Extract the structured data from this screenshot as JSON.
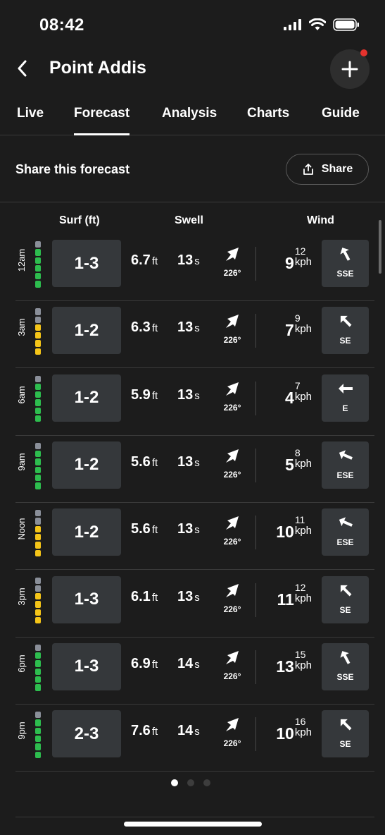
{
  "status_bar": {
    "time": "08:42"
  },
  "header": {
    "title": "Point Addis"
  },
  "tabs": [
    {
      "label": "Live",
      "active": false
    },
    {
      "label": "Forecast",
      "active": true
    },
    {
      "label": "Analysis",
      "active": false
    },
    {
      "label": "Charts",
      "active": false
    },
    {
      "label": "Guide",
      "active": false
    }
  ],
  "share": {
    "text": "Share this forecast",
    "button_label": "Share"
  },
  "columns": {
    "surf": "Surf (ft)",
    "swell": "Swell",
    "wind": "Wind"
  },
  "colors": {
    "green": "#2dbd4e",
    "yellow": "#f5c518",
    "grey": "#8a8f99"
  },
  "rows": [
    {
      "time": "12am",
      "meter": [
        "grey",
        "green",
        "green",
        "green",
        "green",
        "green"
      ],
      "surf": "1-3",
      "swell_height": "6.7",
      "swell_height_unit": "ft",
      "swell_period": "13",
      "swell_period_unit": "s",
      "swell_direction": "226°",
      "wind_speed": "9",
      "wind_gust": "12",
      "wind_unit": "kph",
      "wind_direction": "SSE"
    },
    {
      "time": "3am",
      "meter": [
        "grey",
        "grey",
        "yellow",
        "yellow",
        "yellow",
        "yellow"
      ],
      "surf": "1-2",
      "swell_height": "6.3",
      "swell_height_unit": "ft",
      "swell_period": "13",
      "swell_period_unit": "s",
      "swell_direction": "226°",
      "wind_speed": "7",
      "wind_gust": "9",
      "wind_unit": "kph",
      "wind_direction": "SE"
    },
    {
      "time": "6am",
      "meter": [
        "grey",
        "green",
        "green",
        "green",
        "green",
        "green"
      ],
      "surf": "1-2",
      "swell_height": "5.9",
      "swell_height_unit": "ft",
      "swell_period": "13",
      "swell_period_unit": "s",
      "swell_direction": "226°",
      "wind_speed": "4",
      "wind_gust": "7",
      "wind_unit": "kph",
      "wind_direction": "E"
    },
    {
      "time": "9am",
      "meter": [
        "grey",
        "green",
        "green",
        "green",
        "green",
        "green"
      ],
      "surf": "1-2",
      "swell_height": "5.6",
      "swell_height_unit": "ft",
      "swell_period": "13",
      "swell_period_unit": "s",
      "swell_direction": "226°",
      "wind_speed": "5",
      "wind_gust": "8",
      "wind_unit": "kph",
      "wind_direction": "ESE"
    },
    {
      "time": "Noon",
      "meter": [
        "grey",
        "grey",
        "yellow",
        "yellow",
        "yellow",
        "yellow"
      ],
      "surf": "1-2",
      "swell_height": "5.6",
      "swell_height_unit": "ft",
      "swell_period": "13",
      "swell_period_unit": "s",
      "swell_direction": "226°",
      "wind_speed": "10",
      "wind_gust": "11",
      "wind_unit": "kph",
      "wind_direction": "ESE"
    },
    {
      "time": "3pm",
      "meter": [
        "grey",
        "grey",
        "yellow",
        "yellow",
        "yellow",
        "yellow"
      ],
      "surf": "1-3",
      "swell_height": "6.1",
      "swell_height_unit": "ft",
      "swell_period": "13",
      "swell_period_unit": "s",
      "swell_direction": "226°",
      "wind_speed": "11",
      "wind_gust": "12",
      "wind_unit": "kph",
      "wind_direction": "SE"
    },
    {
      "time": "6pm",
      "meter": [
        "grey",
        "green",
        "green",
        "green",
        "green",
        "green"
      ],
      "surf": "1-3",
      "swell_height": "6.9",
      "swell_height_unit": "ft",
      "swell_period": "14",
      "swell_period_unit": "s",
      "swell_direction": "226°",
      "wind_speed": "13",
      "wind_gust": "15",
      "wind_unit": "kph",
      "wind_direction": "SSE"
    },
    {
      "time": "9pm",
      "meter": [
        "grey",
        "green",
        "green",
        "green",
        "green",
        "green"
      ],
      "surf": "2-3",
      "swell_height": "7.6",
      "swell_height_unit": "ft",
      "swell_period": "14",
      "swell_period_unit": "s",
      "swell_direction": "226°",
      "wind_speed": "10",
      "wind_gust": "16",
      "wind_unit": "kph",
      "wind_direction": "SE"
    }
  ],
  "pagination": {
    "pages": 3,
    "current": 1
  }
}
